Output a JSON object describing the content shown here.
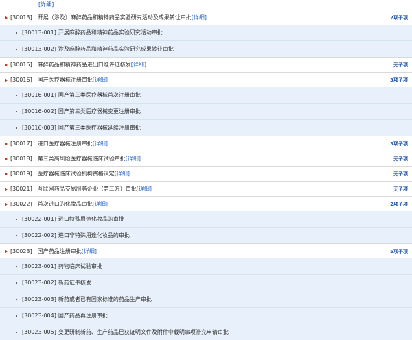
{
  "top_detail": "[详细]",
  "items": [
    {
      "code": "[30013]",
      "title": "开展（涉及）麻醉药品和精神药品实验研究活动及成果转让审批",
      "detail": "[详细]",
      "count": "2项子项",
      "subs": [
        {
          "code": "[30013-001]",
          "title": "开展麻醉药品和精神药品实验研究活动审批"
        },
        {
          "code": "[30013-002]",
          "title": "涉及麻醉药品和精神药品实验研究成果转让审批"
        }
      ]
    },
    {
      "code": "[30015]",
      "title": "麻醉药品和精神药品进出口准许证核发",
      "detail": "[详细]",
      "count": "无子项",
      "subs": []
    },
    {
      "code": "[30016]",
      "title": "国产医疗器械注册审批",
      "detail": "[详细]",
      "count": "3项子项",
      "subs": [
        {
          "code": "[30016-001]",
          "title": "国产第三类医疗器械首次注册审批"
        },
        {
          "code": "[30016-002]",
          "title": "国产第三类医疗器械变更注册审批"
        },
        {
          "code": "[30016-003]",
          "title": "国产第三类医疗器械延续注册审批"
        }
      ]
    },
    {
      "code": "[30017]",
      "title": "进口医疗器械注册审批",
      "detail": "[详细]",
      "count": "3项子项",
      "subs": []
    },
    {
      "code": "[30018]",
      "title": "第三类高风险医疗器械临床试验审批",
      "detail": "[详细]",
      "count": "无子项",
      "subs": []
    },
    {
      "code": "[30019]",
      "title": "医疗器械临床试验机构资格认定",
      "detail": "[详细]",
      "count": "无子项",
      "subs": []
    },
    {
      "code": "[30021]",
      "title": "互联网药品交易服务企业（第三方）审批",
      "detail": "[详细]",
      "count": "无子项",
      "subs": []
    },
    {
      "code": "[30022]",
      "title": "首次进口的化妆品审批",
      "detail": "[详细]",
      "count": "2项子项",
      "subs": [
        {
          "code": "[30022-001]",
          "title": "进口特殊用途化妆品的审批"
        },
        {
          "code": "[30022-002]",
          "title": "进口非特殊用途化妆品的审批"
        }
      ]
    },
    {
      "code": "[30023]",
      "title": "国产药品注册审批",
      "detail": "[详细]",
      "count": "5项子项",
      "subs": [
        {
          "code": "[30023-001]",
          "title": "药物临床试验审批"
        },
        {
          "code": "[30023-002]",
          "title": "新药证书核发"
        },
        {
          "code": "[30023-003]",
          "title": "新药或者已有国家标准的药品生产审批"
        },
        {
          "code": "[30023-004]",
          "title": "国产药品再注册审批"
        },
        {
          "code": "[30023-005]",
          "title": "变更研制新药、生产药品已获证明文件及附件中载明事项补充申请审批"
        }
      ]
    }
  ]
}
